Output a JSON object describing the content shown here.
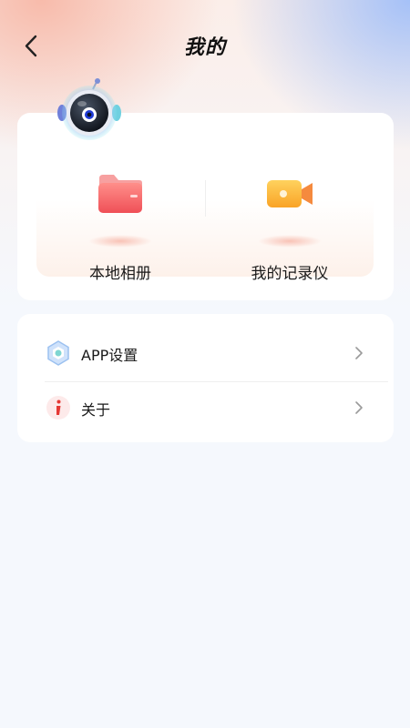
{
  "header": {
    "title": "我的",
    "back_icon": "chevron-left-icon"
  },
  "mascot": {
    "icon": "robot-camera-icon"
  },
  "features": [
    {
      "label": "本地相册",
      "icon": "folder-icon",
      "color": "#f46a6a"
    },
    {
      "label": "我的记录仪",
      "icon": "video-camera-icon",
      "color": "#f7a23b"
    }
  ],
  "menu": [
    {
      "label": "APP设置",
      "icon": "settings-hexagon-icon",
      "color": "#7fb2ee"
    },
    {
      "label": "关于",
      "icon": "info-icon",
      "color": "#e53935"
    }
  ],
  "colors": {
    "background": "#f5f8fd",
    "card": "#ffffff",
    "text": "#1a1a1a"
  }
}
